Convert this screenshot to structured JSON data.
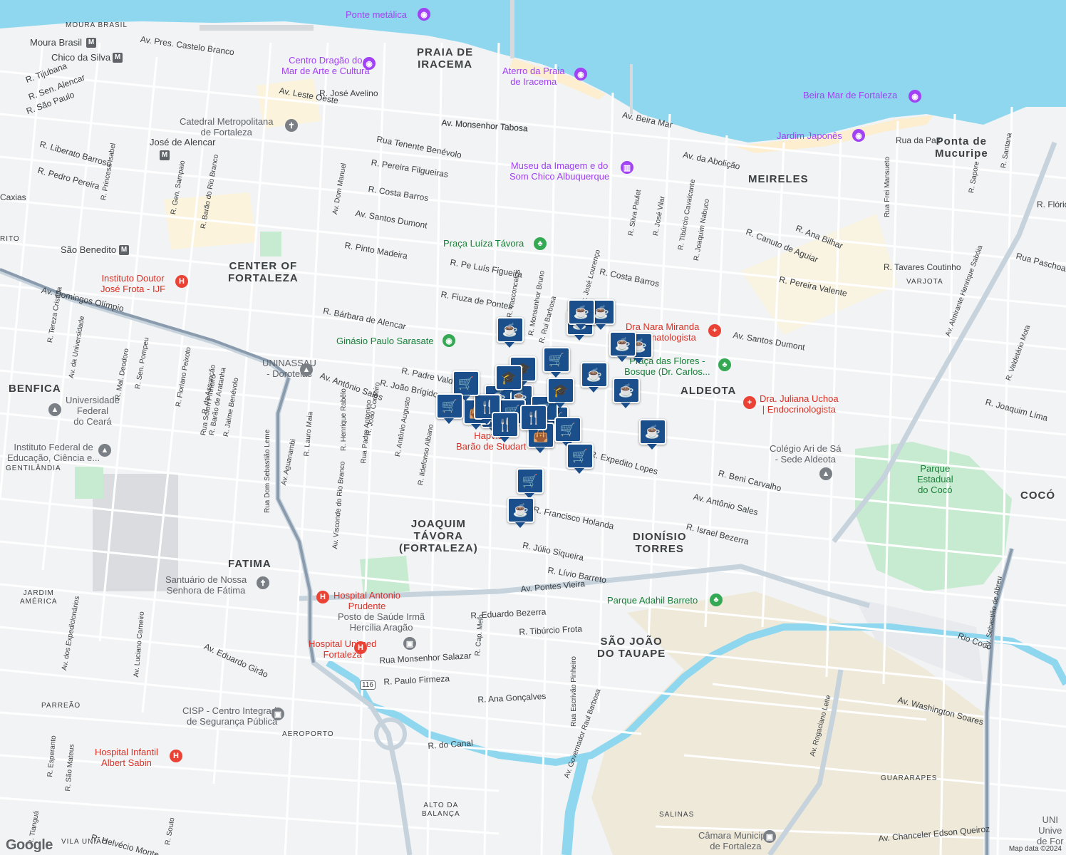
{
  "neighborhoods": [
    {
      "id": "praia-de-iracema",
      "text": "PRAIA DE\nIRACEMA"
    },
    {
      "id": "meireles",
      "text": "MEIRELES"
    },
    {
      "id": "ponta-de-mucuripe",
      "text": "Ponta de\nMucuripe"
    },
    {
      "id": "center-of-fortaleza",
      "text": "CENTER OF\nFORTALEZA"
    },
    {
      "id": "aldeota",
      "text": "ALDEOTA"
    },
    {
      "id": "benfica",
      "text": "BENFICA"
    },
    {
      "id": "joaquim-tavora",
      "text": "JOAQUIM\nTÁVORA\n(FORTALEZA)"
    },
    {
      "id": "dionisio-torres",
      "text": "DIONÍSIO\nTORRES"
    },
    {
      "id": "fatima",
      "text": "FATIMA"
    },
    {
      "id": "sao-joao-do-tauape",
      "text": "SÃO JOÃO\nDO TAUAPE"
    },
    {
      "id": "coco",
      "text": "COCÓ"
    },
    {
      "id": "varjota",
      "text": "VARJOTA"
    },
    {
      "id": "gentilandia",
      "text": "GENTILÂNDIA"
    },
    {
      "id": "jardim-america",
      "text": "JARDIM\nAMÉRICA"
    },
    {
      "id": "parreao",
      "text": "PARREÃO"
    },
    {
      "id": "vila-uniao",
      "text": "VILA UNIÃO"
    },
    {
      "id": "alto-da-balanca",
      "text": "ALTO DA\nBALANÇA"
    },
    {
      "id": "guararapes",
      "text": "GUARARAPES"
    },
    {
      "id": "salinas",
      "text": "SALINAS"
    },
    {
      "id": "moura-brasil",
      "text": "MOURA BRASIL"
    },
    {
      "id": "aeroporto",
      "text": "AEROPORTO"
    },
    {
      "id": "rito",
      "text": "RITO"
    }
  ],
  "pois": [
    {
      "id": "ponte-metalica",
      "text": "Ponte metálica",
      "icon": "camera-icon",
      "color": "purple"
    },
    {
      "id": "centro-dragao",
      "text": "Centro Dragão do\nMar de Arte e Cultura",
      "icon": "camera-icon",
      "color": "purple"
    },
    {
      "id": "aterro-praia",
      "text": "Aterro da Praia\nde Iracema",
      "icon": "camera-icon",
      "color": "purple"
    },
    {
      "id": "beira-mar",
      "text": "Beira Mar de Fortaleza",
      "icon": "camera-icon",
      "color": "purple"
    },
    {
      "id": "jardim-japones",
      "text": "Jardim Japonês",
      "icon": "camera-icon",
      "color": "purple"
    },
    {
      "id": "museu-imagem",
      "text": "Museu da Imagem e do\nSom Chico Albuquerque",
      "icon": "museum-icon",
      "color": "purple"
    },
    {
      "id": "catedral",
      "text": "Catedral Metropolitana\nde Fortaleza",
      "icon": "church-icon",
      "color": "gray"
    },
    {
      "id": "praca-luiza",
      "text": "Praça Luíza Távora",
      "icon": "tree-icon",
      "color": "green"
    },
    {
      "id": "instituto-frota",
      "text": "Instituto Doutor\nJosé Frota - IJF",
      "icon": "hospital-icon",
      "color": "red"
    },
    {
      "id": "ginasio",
      "text": "Ginásio Paulo Sarasate",
      "icon": "stadium-icon",
      "color": "green"
    },
    {
      "id": "dra-nara",
      "text": "Dra Nara Miranda\n| Dermatologista",
      "icon": "medical-icon",
      "color": "red"
    },
    {
      "id": "praca-flores",
      "text": "Praça das Flores -\nBosque (Dr. Carlos...",
      "icon": "tree-icon",
      "color": "green"
    },
    {
      "id": "uninassau",
      "text": "UNINASSAU\n- Doroteias",
      "icon": "school-icon",
      "color": "gray"
    },
    {
      "id": "dra-juliana",
      "text": "Dra. Juliana Uchoa\n| Endocrinologista",
      "icon": "medical-icon",
      "color": "red"
    },
    {
      "id": "ufc",
      "text": "Universidade\nFederal\ndo Ceará",
      "icon": "school-icon",
      "color": "gray"
    },
    {
      "id": "instituto-federal",
      "text": "Instituto Federal de\nEducação, Ciência e...",
      "icon": "school-icon",
      "color": "gray"
    },
    {
      "id": "colegio-ari",
      "text": "Colégio Ari de Sá\n- Sede Aldeota",
      "icon": "school-icon",
      "color": "gray"
    },
    {
      "id": "parque-coco",
      "text": "Parque\nEstadual\ndo Cocó",
      "icon": "",
      "color": "green"
    },
    {
      "id": "hapvida",
      "text": "Hapvida\nBarão de Studart",
      "icon": "",
      "color": "red"
    },
    {
      "id": "santuario",
      "text": "Santuário de Nossa\nSenhora de Fátima",
      "icon": "church-icon",
      "color": "gray"
    },
    {
      "id": "hospital-antonio",
      "text": "Hospital Antonio\nPrudente",
      "icon": "hospital-icon",
      "color": "red"
    },
    {
      "id": "parque-adahil",
      "text": "Parque Adahil Barreto",
      "icon": "tree-icon",
      "color": "green"
    },
    {
      "id": "posto-saude",
      "text": "Posto de Saúde Irmã\nHercília Aragão",
      "icon": "building-icon",
      "color": "gray"
    },
    {
      "id": "hospital-unimed",
      "text": "Hospital Unimed\nFortaleza",
      "icon": "hospital-icon",
      "color": "red"
    },
    {
      "id": "cisp",
      "text": "CISP - Centro Integrado\nde Segurança Pública",
      "icon": "building-icon",
      "color": "gray"
    },
    {
      "id": "hospital-sabin",
      "text": "Hospital Infantil\nAlbert Sabin",
      "icon": "hospital-icon",
      "color": "red"
    },
    {
      "id": "camara",
      "text": "Câmara Municipal\nde Fortaleza",
      "icon": "building-icon",
      "color": "gray"
    },
    {
      "id": "unichristus",
      "text": "UNI\nUnive\nde For",
      "icon": "",
      "color": "gray"
    }
  ],
  "metro_stations": [
    {
      "id": "moura-brasil-st",
      "text": "Moura Brasil"
    },
    {
      "id": "chico-silva",
      "text": "Chico da Silva"
    },
    {
      "id": "jose-alencar",
      "text": "José de Alencar"
    },
    {
      "id": "sao-benedito",
      "text": "São Benedito"
    }
  ],
  "streets": [
    "Av. Pres. Castelo Branco",
    "Av. Leste Oeste",
    "R. José Avelino",
    "Av. Monsenhor Tabosa",
    "Rua Tenente Benévolo",
    "R. Pereira Filgueiras",
    "R. Costa Barros",
    "Av. Santos Dumont",
    "R. Pinto Madeira",
    "R. Pe Luís Figueira",
    "R. Fiuza de Pontes",
    "R. Bárbara de Alencar",
    "R. Padre Valdevino",
    "R. João Brígido",
    "Av. Antônio Sales",
    "Av. Domingos Olímpio",
    "Av. da Universidade",
    "R. Mal. Deodoro",
    "R. Sen. Pompeu",
    "R. Gen. Sampaio",
    "R. Barão do Rio Branco",
    "Av. Dom Manuel",
    "R. João Cordeiro",
    "R. Antônio Augusto",
    "Av. Beira Mar",
    "Av. da Abolição",
    "R. Silva Paulet",
    "R. José Vilar",
    "R. Tibúrcio Cavalcante",
    "R. Joaquim Nabuco",
    "R. Canuto de Aguiar",
    "R. Ana Bilhar",
    "R. Pereira Valente",
    "R. Tavares Coutinho",
    "R. Costa Barros",
    "Av. Santos Dumont",
    "R. Beni Carvalho",
    "Av. Antônio Sales",
    "R. Israel Bezerra",
    "R. Francisco Holanda",
    "R. Júlio Siqueira",
    "R. Lívio Barreto",
    "Av. Pontes Vieira",
    "R. Eduardo Bezerra",
    "R. Tibúrcio Frota",
    "Rua Monsenhor Salazar",
    "R. Paulo Firmeza",
    "R. Ana Gonçalves",
    "R. do Canal",
    "Av. Governador Raul Barbosa",
    "Rua Escrivão Pinheiro",
    "Av. Aguanambi",
    "R. Lauro Maia",
    "Av. Visconde do Rio Branco",
    "Rua Dom Sebastião Leme",
    "Av. Eduardo Girão",
    "Av. Luciano Carneiro",
    "Av. dos Expedicionários",
    "Av. Washington Soares",
    "Av. Rogaciano Leite",
    "Av. Sebastião de Abreu",
    "Av. Chanceler Edson Queiroz",
    "Av. Almirante Henrique Sabóia",
    "Rua Frei Mansueto",
    "Rio Cocó",
    "R. Valdetário Mota",
    "R. Joaquim Lima",
    "Rua Paschoal",
    "R. Expedito Lopes",
    "R. Cap. Melo",
    "Rua Padre Antonino",
    "R. Henrique Rabêlo",
    "R. Ildefonso Albano",
    "R. Floriano Peixoto",
    "Rua Solon Pinheiro",
    "R. Barão de Aratanha",
    "R. Jaime Benévolo",
    "R. Tereza Cristina",
    "R. Liberato Barroso",
    "R. Pedro Pereira",
    "R. Princesa Isabel",
    "R. Tijubana",
    "R. Sen. Alencar",
    "R. São Paulo",
    "R. Rui Barbosa",
    "R. Monsenhor Bruno",
    "R. Dr. José Lourenço",
    "R. Vasconcelos",
    "R. Helvécio Monte",
    "R. Tianguá",
    "R. Esperanto",
    "R. São Mateus",
    "R. Souto",
    "Rua da Paz",
    "R. Sapore",
    "R. Santana",
    "R. Flórida",
    "Caxias",
    "Av. Monsenhor Tabosa",
    "R. da Assunção"
  ],
  "pins": [
    {
      "id": "pin-1",
      "icon": "coffee-icon"
    },
    {
      "id": "pin-2",
      "icon": "coffee-icon"
    },
    {
      "id": "pin-3",
      "icon": "coffee-icon"
    },
    {
      "id": "pin-4",
      "icon": "coffee-icon"
    },
    {
      "id": "pin-5",
      "icon": "coffee-icon"
    },
    {
      "id": "pin-6",
      "icon": "coffee-icon"
    },
    {
      "id": "pin-7",
      "icon": "coffee-icon"
    },
    {
      "id": "pin-8",
      "icon": "coffee-icon"
    },
    {
      "id": "pin-9",
      "icon": "coffee-icon"
    },
    {
      "id": "pin-10",
      "icon": "coffee-icon"
    },
    {
      "id": "pin-11",
      "icon": "cart-icon"
    },
    {
      "id": "pin-12",
      "icon": "cart-icon"
    },
    {
      "id": "pin-13",
      "icon": "cart-icon"
    },
    {
      "id": "pin-14",
      "icon": "cart-icon"
    },
    {
      "id": "pin-15",
      "icon": "cart-icon"
    },
    {
      "id": "pin-16",
      "icon": "cart-icon"
    },
    {
      "id": "pin-17",
      "icon": "school-icon"
    },
    {
      "id": "pin-18",
      "icon": "school-icon"
    },
    {
      "id": "pin-19",
      "icon": "school-icon"
    },
    {
      "id": "pin-20",
      "icon": "restaurant-icon"
    },
    {
      "id": "pin-21",
      "icon": "restaurant-icon"
    },
    {
      "id": "pin-22",
      "icon": "restaurant-icon"
    },
    {
      "id": "pin-23",
      "icon": "bag-icon"
    },
    {
      "id": "pin-24",
      "icon": "bag-icon"
    },
    {
      "id": "pin-25",
      "icon": "cart-icon"
    },
    {
      "id": "pin-26",
      "icon": "coffee-icon"
    },
    {
      "id": "pin-27",
      "icon": "cart-icon"
    },
    {
      "id": "pin-28",
      "icon": "coffee-icon"
    },
    {
      "id": "pin-29",
      "icon": "cart-icon"
    },
    {
      "id": "pin-30",
      "icon": "coffee-icon"
    }
  ],
  "route_shields": [
    "116"
  ],
  "attribution": "Map data ©2024",
  "logo": "Google"
}
